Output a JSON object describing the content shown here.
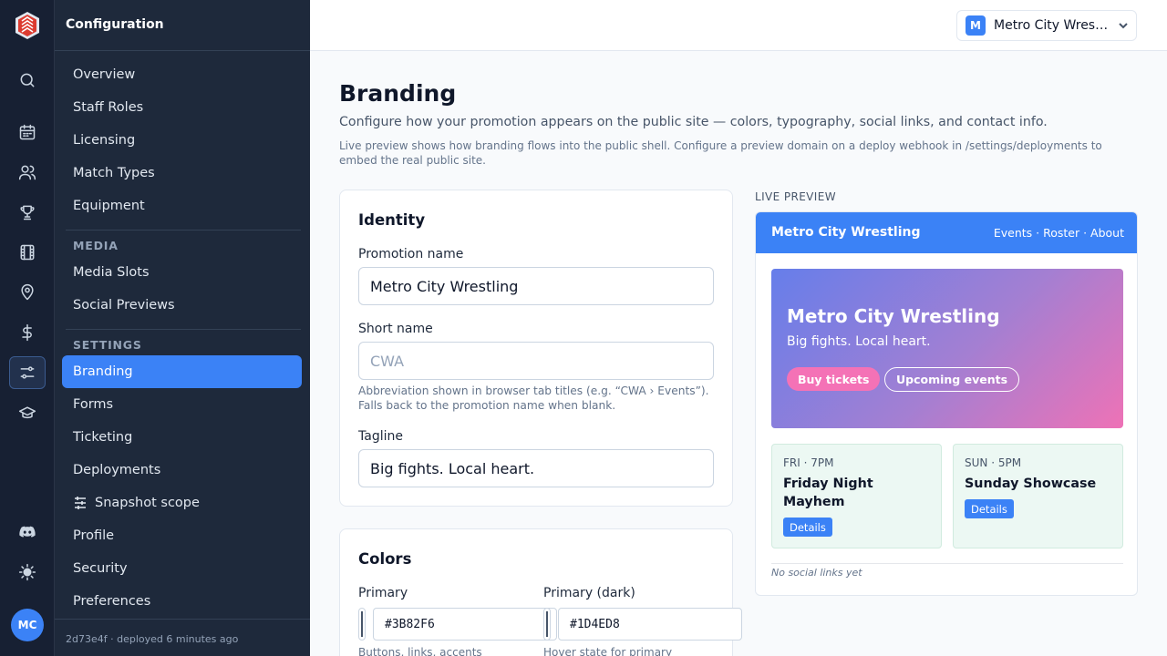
{
  "rail": {
    "icons": [
      "search-icon",
      "calendar-icon",
      "users-icon",
      "trophy-icon",
      "film-icon",
      "map-pin-icon",
      "dollar-icon",
      "sliders-icon",
      "graduation-cap-icon",
      "discord-icon",
      "sun-icon"
    ],
    "active": "sliders-icon",
    "avatar_initials": "MC"
  },
  "sidebar": {
    "title": "Configuration",
    "items_top": [
      "Overview",
      "Staff Roles",
      "Licensing",
      "Match Types",
      "Equipment"
    ],
    "media_section": "MEDIA",
    "items_media": [
      "Media Slots",
      "Social Previews"
    ],
    "settings_section": "SETTINGS",
    "items_settings": [
      "Branding",
      "Forms",
      "Ticketing",
      "Deployments",
      "Snapshot scope",
      "Profile",
      "Security",
      "Preferences"
    ],
    "active_item": "Branding",
    "footer": "2d73e4f  · deployed 6 minutes ago"
  },
  "header": {
    "org_initial": "M",
    "org_name": "Metro City Wrestling"
  },
  "page": {
    "title": "Branding",
    "subtitle": "Configure how your promotion appears on the public site — colors, typography, social links, and contact info.",
    "note": "Live preview shows how branding flows into the public shell. Configure a preview domain on a deploy webhook in /settings/deployments to embed the real public site."
  },
  "identity": {
    "heading": "Identity",
    "promotion_name_label": "Promotion name",
    "promotion_name_value": "Metro City Wrestling",
    "short_name_label": "Short name",
    "short_name_placeholder": "CWA",
    "short_name_help": "Abbreviation shown in browser tab titles (e.g. “CWA › Events”). Falls back to the promotion name when blank.",
    "tagline_label": "Tagline",
    "tagline_value": "Big fights. Local heart."
  },
  "colors": {
    "heading": "Colors",
    "primary_label": "Primary",
    "primary_value": "#3B82F6",
    "primary_help": "Buttons, links, accents",
    "primary_dark_label": "Primary (dark)",
    "primary_dark_value": "#1D4ED8",
    "primary_dark_help": "Hover state for primary"
  },
  "preview": {
    "label": "LIVE PREVIEW",
    "brand": "Metro City Wrestling",
    "nav_links": "Events · Roster · About",
    "hero_title": "Metro City Wrestling",
    "hero_tagline": "Big fights. Local heart.",
    "buy_button": "Buy tickets",
    "upcoming_button": "Upcoming events",
    "events": [
      {
        "when": "FRI · 7PM",
        "name": "Friday Night Mayhem",
        "button": "Details"
      },
      {
        "when": "SUN · 5PM",
        "name": "Sunday Showcase",
        "button": "Details"
      }
    ],
    "social_note": "No social links yet",
    "accent_color": "#3B82F6",
    "secondary_color": "#F472B6"
  }
}
